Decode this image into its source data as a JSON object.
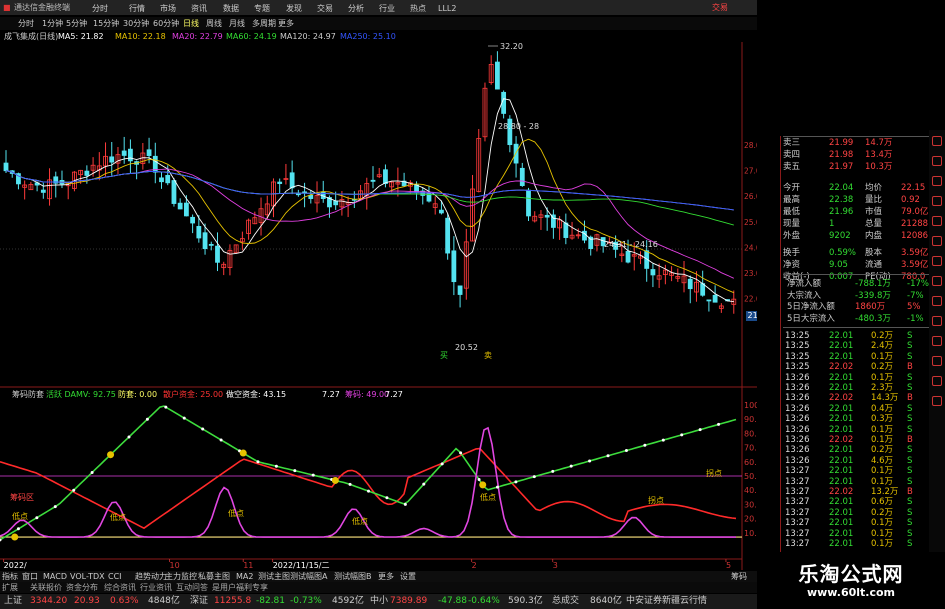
{
  "window": {
    "title": "通达信金融终端",
    "top_right": "交易"
  },
  "menu": [
    "分时",
    "行情",
    "市场",
    "资讯",
    "数据",
    "专题",
    "发现",
    "交易",
    "分析",
    "行业",
    "热点",
    "LLL2"
  ],
  "periods": [
    "分时",
    "1分钟",
    "5分钟",
    "15分钟",
    "30分钟",
    "60分钟",
    "日线",
    "周线",
    "月线",
    "多周期",
    "更多"
  ],
  "ma": {
    "name": "成飞集成(日线)",
    "items": [
      {
        "label": "MA5: 21.82",
        "color": "#ffffff"
      },
      {
        "label": "MA10: 22.18",
        "color": "#e6c200"
      },
      {
        "label": "MA20: 22.79",
        "color": "#e040e0"
      },
      {
        "label": "MA60: 24.19",
        "color": "#33dd33"
      },
      {
        "label": "MA120: 24.97",
        "color": "#cccccc"
      },
      {
        "label": "MA250: 25.10",
        "color": "#3355ff"
      }
    ]
  },
  "price_annotations": {
    "high": "32.20",
    "mid": "28.80",
    "low": "20.52",
    "range": "24.31 - 24.16",
    "tag_buy": "买",
    "tag_sell": "卖"
  },
  "price_axis": [
    "28.00",
    "27.00",
    "26.00",
    "25.00",
    "24.00",
    "23.00",
    "22.00"
  ],
  "last_price": "21.52",
  "indicator": {
    "name": "筹码防套",
    "items": [
      {
        "label": "活跃 DAMV: 92.75",
        "color": "#33dd33"
      },
      {
        "label": "防套: 0.00",
        "color": "#ffff66"
      },
      {
        "label": "散户资金: 25.00",
        "color": "#ff3333"
      },
      {
        "label": "做空资金: 43.15",
        "color": "#ffffff"
      },
      {
        "label": "",
        "color": "#3355ff"
      },
      {
        "label": "7.27",
        "color": "#ffffff"
      },
      {
        "label": "筹码: 49.00",
        "color": "#e040e0"
      },
      {
        "label": "7.27",
        "color": "#ffffff"
      }
    ],
    "labels": {
      "buy_area": "筹码区",
      "low_tag": "低点",
      "high_tag": "拐点"
    }
  },
  "ind_axis": [
    "100.0",
    "90.00",
    "80.00",
    "70.00",
    "60.00",
    "50.00",
    "40.00",
    "30.00",
    "20.00",
    "10.00"
  ],
  "time_axis": [
    {
      "label": "2022/",
      "t": 0.005
    },
    {
      "label": "10",
      "t": 0.23
    },
    {
      "label": "11",
      "t": 0.33
    },
    {
      "label": "2022/11/15/二",
      "t": 0.37
    },
    {
      "label": "2",
      "t": 0.64
    },
    {
      "label": "3",
      "t": 0.75
    },
    {
      "label": "5",
      "t": 0.985
    }
  ],
  "tabs": [
    "指标",
    "窗口",
    "MACD",
    "VOL-TDX",
    "CCI",
    "趋势动力",
    "主力监控",
    "私募主图",
    "MA2",
    "测试主图",
    "测试幅图A",
    "测试幅图B",
    "更多",
    "设置"
  ],
  "tabs2": [
    "扩展",
    "关联报价",
    "资金分布",
    "综合资讯",
    "行业资讯",
    "互动问答",
    "是用户福利专享"
  ],
  "status": [
    {
      "label": "上证",
      "color": "#cccccc"
    },
    {
      "label": "3344.20",
      "color": "#ff4444"
    },
    {
      "label": "20.93",
      "color": "#ff4444"
    },
    {
      "label": "0.63%",
      "color": "#ff4444"
    },
    {
      "label": "4848亿",
      "color": "#cccccc"
    },
    {
      "label": "深证",
      "color": "#cccccc"
    },
    {
      "label": "11255.8",
      "color": "#ff4444"
    },
    {
      "label": "-82.81",
      "color": "#33dd33"
    },
    {
      "label": "-0.73%",
      "color": "#33dd33"
    },
    {
      "label": "4592亿",
      "color": "#cccccc"
    },
    {
      "label": "中小",
      "color": "#cccccc"
    },
    {
      "label": "7389.89",
      "color": "#ff4444"
    },
    {
      "label": "-47.88",
      "color": "#33dd33"
    },
    {
      "label": "-0.64%",
      "color": "#33dd33"
    },
    {
      "label": "590.3亿",
      "color": "#cccccc"
    },
    {
      "label": "总成交",
      "color": "#cccccc"
    },
    {
      "label": "8640亿",
      "color": "#cccccc"
    },
    {
      "label": "中安证券新疆云行情",
      "color": "#cccccc"
    }
  ],
  "quotes": [
    {
      "label": "卖三",
      "value": "21.99",
      "vol": "14.7万",
      "vc": "#ff4444"
    },
    {
      "label": "卖四",
      "value": "21.98",
      "vol": "13.4万",
      "vc": "#ff4444"
    },
    {
      "label": "卖五",
      "value": "21.97",
      "vol": "10.3万",
      "vc": "#ff4444"
    },
    {
      "label": "今开",
      "value": "22.04",
      "vol": "均价",
      "vc": "#cccccc",
      "extra": "22.15"
    },
    {
      "label": "最高",
      "value": "22.38",
      "vol": "量比",
      "vc": "#cccccc",
      "extra": "0.92"
    },
    {
      "label": "最低",
      "value": "21.96",
      "vol": "市值",
      "vc": "#cccccc",
      "extra": "79.0亿"
    },
    {
      "label": "现量",
      "value": "1",
      "vol": "总量",
      "vc": "#cccccc",
      "extra": "21288"
    },
    {
      "label": "外盘",
      "value": "9202",
      "vol": "内盘",
      "vc": "#cccccc",
      "extra": "12086"
    },
    {
      "label": "换手",
      "value": "0.59%",
      "vol": "股本",
      "vc": "#cccccc",
      "extra": "3.59亿"
    },
    {
      "label": "净资",
      "value": "9.05",
      "vol": "流通",
      "vc": "#cccccc",
      "extra": "3.59亿"
    },
    {
      "label": "收益(-)",
      "value": "0.007",
      "vol": "PE(动)",
      "vc": "#cccccc",
      "extra": "780.0"
    }
  ],
  "flows": [
    {
      "label": "净流入额",
      "value": "-788.1万",
      "pct": "-17%"
    },
    {
      "label": "大宗流入",
      "value": "-339.8万",
      "pct": "-7%"
    },
    {
      "label": "5日净流入额",
      "value": "1860万",
      "pct": "5%"
    },
    {
      "label": "5日大宗流入",
      "value": "-480.3万",
      "pct": "-1%"
    }
  ],
  "ticks": [
    {
      "t": "13:25",
      "p": "22.01",
      "v": "0.2万",
      "bs": "S"
    },
    {
      "t": "13:25",
      "p": "22.01",
      "v": "2.4万",
      "bs": "S"
    },
    {
      "t": "13:25",
      "p": "22.01",
      "v": "0.1万",
      "bs": "S"
    },
    {
      "t": "13:25",
      "p": "22.02",
      "v": "0.2万",
      "bs": "B"
    },
    {
      "t": "13:26",
      "p": "22.01",
      "v": "0.1万",
      "bs": "S"
    },
    {
      "t": "13:26",
      "p": "22.01",
      "v": "2.3万",
      "bs": "S"
    },
    {
      "t": "13:26",
      "p": "22.02",
      "v": "14.3万",
      "bs": "B"
    },
    {
      "t": "13:26",
      "p": "22.01",
      "v": "0.4万",
      "bs": "S"
    },
    {
      "t": "13:26",
      "p": "22.01",
      "v": "0.3万",
      "bs": "S"
    },
    {
      "t": "13:26",
      "p": "22.01",
      "v": "0.1万",
      "bs": "S"
    },
    {
      "t": "13:26",
      "p": "22.02",
      "v": "0.1万",
      "bs": "B"
    },
    {
      "t": "13:26",
      "p": "22.01",
      "v": "0.2万",
      "bs": "S"
    },
    {
      "t": "13:26",
      "p": "22.01",
      "v": "4.6万",
      "bs": "S"
    },
    {
      "t": "13:27",
      "p": "22.01",
      "v": "0.1万",
      "bs": "S"
    },
    {
      "t": "13:27",
      "p": "22.01",
      "v": "0.1万",
      "bs": "S"
    },
    {
      "t": "13:27",
      "p": "22.02",
      "v": "13.2万",
      "bs": "B"
    },
    {
      "t": "13:27",
      "p": "22.01",
      "v": "0.6万",
      "bs": "S"
    },
    {
      "t": "13:27",
      "p": "22.01",
      "v": "0.2万",
      "bs": "S"
    },
    {
      "t": "13:27",
      "p": "22.01",
      "v": "0.1万",
      "bs": "S"
    },
    {
      "t": "13:27",
      "p": "22.01",
      "v": "0.1万",
      "bs": "S"
    },
    {
      "t": "13:27",
      "p": "22.01",
      "v": "0.1万",
      "bs": "S"
    }
  ],
  "bottom_panel": {
    "left": "图文F10",
    "right": "筹码"
  },
  "brand": {
    "title": "乐淘公式网",
    "url": "www.60lt.com"
  }
}
